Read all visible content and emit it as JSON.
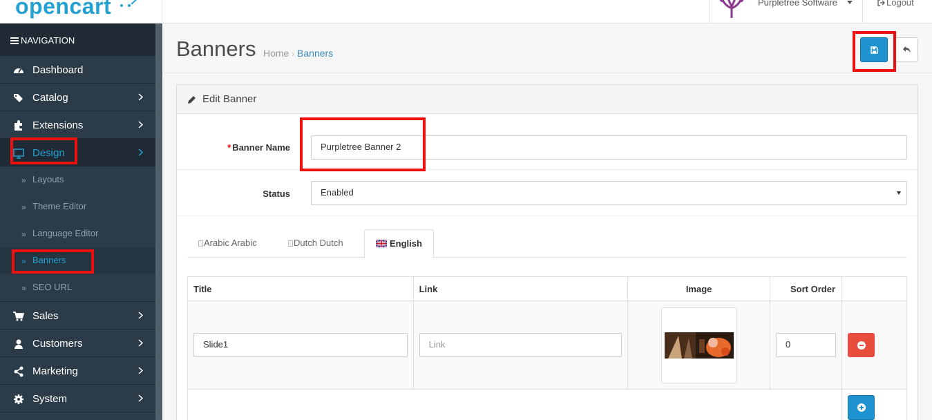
{
  "header": {
    "logo_text": "opencart",
    "user_name": "Purpletree Software",
    "logout_label": "Logout"
  },
  "sidebar": {
    "heading": "NAVIGATION",
    "items": [
      {
        "label": "Dashboard",
        "icon": "dashboard-icon"
      },
      {
        "label": "Catalog",
        "icon": "tags-icon"
      },
      {
        "label": "Extensions",
        "icon": "puzzle-icon"
      },
      {
        "label": "Design",
        "icon": "monitor-icon"
      },
      {
        "label": "Sales",
        "icon": "cart-icon"
      },
      {
        "label": "Customers",
        "icon": "user-icon"
      },
      {
        "label": "Marketing",
        "icon": "share-icon"
      },
      {
        "label": "System",
        "icon": "cog-icon"
      }
    ],
    "design_children": [
      "Layouts",
      "Theme Editor",
      "Language Editor",
      "Banners",
      "SEO URL"
    ]
  },
  "page": {
    "title": "Banners",
    "breadcrumb": [
      "Home",
      "Banners"
    ]
  },
  "panel": {
    "heading": "Edit Banner",
    "banner_name_label": "Banner Name",
    "banner_name_value": "Purpletree Banner 2",
    "status_label": "Status",
    "status_value": "Enabled"
  },
  "tabs": [
    {
      "alt": "Arabic",
      "label": "Arabic"
    },
    {
      "alt": "Dutch",
      "label": "Dutch"
    },
    {
      "alt": "",
      "label": "English"
    }
  ],
  "table": {
    "headers": [
      "Title",
      "Link",
      "Image",
      "Sort Order"
    ],
    "row": {
      "title_value": "Slide1",
      "link_placeholder": "Link",
      "sort_order_value": "0"
    }
  },
  "colors": {
    "primary": "#1e91cf",
    "danger": "#e74c3c",
    "highlight": "#ee0f0f",
    "sidebar_bg": "#2c3b48"
  }
}
